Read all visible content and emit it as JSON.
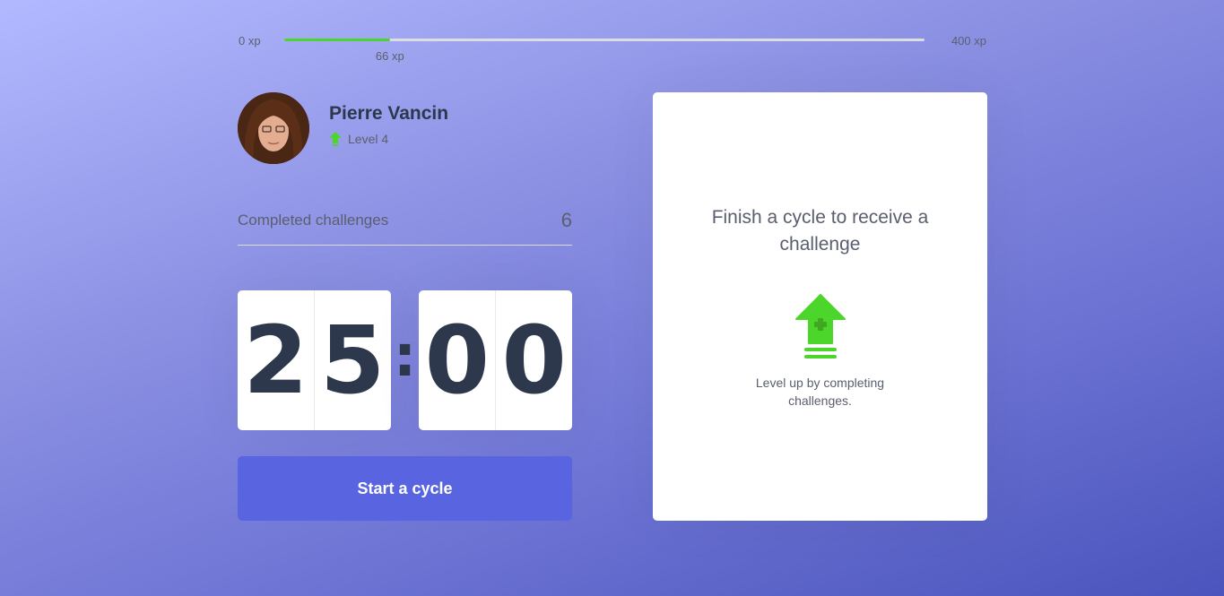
{
  "xp": {
    "min_label": "0 xp",
    "max_label": "400 xp",
    "current_label": "66 xp",
    "current": 66,
    "max": 400
  },
  "profile": {
    "name": "Pierre Vancin",
    "level_label": "Level 4"
  },
  "completed": {
    "label": "Completed challenges",
    "value": "6"
  },
  "countdown": {
    "minute_left": "2",
    "minute_right": "5",
    "separator": ":",
    "second_left": "0",
    "second_right": "0"
  },
  "button": {
    "label": "Start a cycle"
  },
  "challenge": {
    "title": "Finish a cycle to receive a challenge",
    "hint": "Level up by completing challenges."
  },
  "colors": {
    "accent": "#5965e0",
    "green": "#4cd62b",
    "title": "#2e384d",
    "text": "#666666"
  },
  "icons": {
    "level": "level-up-arrow-icon",
    "levelup": "level-up-icon"
  }
}
